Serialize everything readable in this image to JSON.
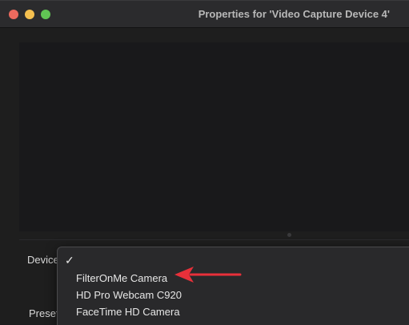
{
  "window": {
    "title": "Properties for 'Video Capture Device 4'"
  },
  "form": {
    "device_label": "Device",
    "preset_label": "Preset"
  },
  "device_menu": {
    "items": [
      {
        "label": "",
        "checked": true
      },
      {
        "label": "FilterOnMe Camera",
        "checked": false
      },
      {
        "label": "HD Pro Webcam C920",
        "checked": false
      },
      {
        "label": "FaceTime HD Camera",
        "checked": false
      }
    ]
  },
  "annotation": {
    "arrow_color": "#e8303a",
    "arrow_target": "FilterOnMe Camera"
  },
  "colors": {
    "close": "#ec6a5e",
    "minimize": "#f4bf4f",
    "zoom": "#61c554"
  }
}
